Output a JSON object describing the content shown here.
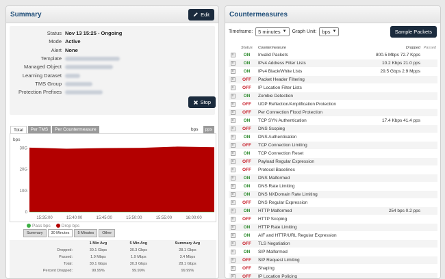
{
  "summary": {
    "title": "Summary",
    "edit_label": "Edit",
    "stop_label": "Stop",
    "fields": [
      {
        "key": "Status",
        "value": "Nov 13 15:25 - Ongoing",
        "blurred": false
      },
      {
        "key": "Mode",
        "value": "Active",
        "blurred": false
      },
      {
        "key": "Alert",
        "value": "None",
        "blurred": false
      },
      {
        "key": "Template",
        "value": "",
        "blurred": true,
        "w": 80
      },
      {
        "key": "Managed Object",
        "value": "",
        "blurred": true,
        "w": 70
      },
      {
        "key": "Learning Dataset",
        "value": "",
        "blurred": true,
        "w": 22
      },
      {
        "key": "TMS Group",
        "value": "",
        "blurred": true,
        "w": 40
      },
      {
        "key": "Protection Prefixes",
        "value": "",
        "blurred": true,
        "w": 55
      }
    ]
  },
  "chart_tabs": [
    "Total",
    "Per TMS",
    "Per Countermeasure"
  ],
  "unit_tabs": [
    "bps",
    "pps"
  ],
  "chart_data": {
    "type": "area",
    "ylabel": "bps",
    "x": [
      "15:35:00",
      "15:40:00",
      "15:45:00",
      "15:50:00",
      "15:55:00",
      "16:00:00"
    ],
    "yticks": [
      "0",
      "10G",
      "20G",
      "30G"
    ],
    "ylim": [
      0,
      32
    ],
    "series": [
      {
        "name": "Pass bps",
        "color": "#3cb043",
        "values": [
          0.002,
          0.002,
          0.002,
          0.002,
          0.002,
          0.002
        ]
      },
      {
        "name": "Drop bps",
        "color": "#b30000",
        "values": [
          30.1,
          29.6,
          29.9,
          30.0,
          30.6,
          30.3
        ]
      }
    ]
  },
  "range_buttons": [
    "Summary",
    "30 Minutes",
    "5 Minutes",
    "Other"
  ],
  "stats": {
    "headers": [
      "",
      "1 Min Avg",
      "5 Min Avg",
      "Summary Avg"
    ],
    "rows": [
      [
        "Dropped:",
        "30.1 Gbps",
        "30.3 Gbps",
        "28.1 Gbps"
      ],
      [
        "Passed:",
        "1.9 Mbps",
        "1.9 Mbps",
        "3.4 Mbps"
      ],
      [
        "Total:",
        "30.1 Gbps",
        "30.3 Gbps",
        "28.1 Gbps"
      ],
      [
        "Percent Dropped:",
        "99.99%",
        "99.99%",
        "99.99%"
      ]
    ]
  },
  "countermeasures": {
    "title": "Countermeasures",
    "timeframe_label": "Timeframe:",
    "timeframe_value": "5 minutes",
    "unit_label": "Graph Unit:",
    "unit_value": "bps",
    "sample_label": "Sample Packets",
    "columns": {
      "status": "Status",
      "name": "Countermeasure",
      "dropped": "Dropped",
      "passed": "Passed"
    },
    "rows": [
      {
        "s": "ON",
        "n": "Invalid Packets",
        "d": "800.5 Mbps 72.7 Kpps"
      },
      {
        "s": "ON",
        "n": "IPv4 Address Filter Lists",
        "d": "10.2 Kbps 21.0 pps"
      },
      {
        "s": "ON",
        "n": "IPv4 Black/White Lists",
        "d": "29.5 Gbps 2.9 Mpps"
      },
      {
        "s": "OFF",
        "n": "Packet Header Filtering",
        "d": ""
      },
      {
        "s": "OFF",
        "n": "IP Location Filter Lists",
        "d": ""
      },
      {
        "s": "ON",
        "n": "Zombie Detection",
        "d": ""
      },
      {
        "s": "OFF",
        "n": "UDP Reflection/Amplification Protection",
        "d": ""
      },
      {
        "s": "OFF",
        "n": "Per Connection Flood Protection",
        "d": ""
      },
      {
        "s": "ON",
        "n": "TCP SYN Authentication",
        "d": "17.4 Kbps 41.4 pps"
      },
      {
        "s": "OFF",
        "n": "DNS Scoping",
        "d": ""
      },
      {
        "s": "ON",
        "n": "DNS Authentication",
        "d": ""
      },
      {
        "s": "OFF",
        "n": "TCP Connection Limiting",
        "d": ""
      },
      {
        "s": "ON",
        "n": "TCP Connection Reset",
        "d": ""
      },
      {
        "s": "OFF",
        "n": "Payload Regular Expression",
        "d": ""
      },
      {
        "s": "OFF",
        "n": "Protocol Baselines",
        "d": ""
      },
      {
        "s": "ON",
        "n": "DNS Malformed",
        "d": ""
      },
      {
        "s": "ON",
        "n": "DNS Rate Limiting",
        "d": ""
      },
      {
        "s": "ON",
        "n": "DNS NXDomain Rate Limiting",
        "d": ""
      },
      {
        "s": "OFF",
        "n": "DNS Regular Expression",
        "d": ""
      },
      {
        "s": "ON",
        "n": "HTTP Malformed",
        "d": "254 bps 0.2 pps"
      },
      {
        "s": "OFF",
        "n": "HTTP Scoping",
        "d": ""
      },
      {
        "s": "ON",
        "n": "HTTP Rate Limiting",
        "d": ""
      },
      {
        "s": "ON",
        "n": "AIF and HTTP/URL Regular Expression",
        "d": ""
      },
      {
        "s": "OFF",
        "n": "TLS Negotiation",
        "d": ""
      },
      {
        "s": "ON",
        "n": "SIP Malformed",
        "d": ""
      },
      {
        "s": "OFF",
        "n": "SIP Request Limiting",
        "d": ""
      },
      {
        "s": "OFF",
        "n": "Shaping",
        "d": ""
      },
      {
        "s": "OFF",
        "n": "IP Location Policing",
        "d": ""
      }
    ]
  }
}
